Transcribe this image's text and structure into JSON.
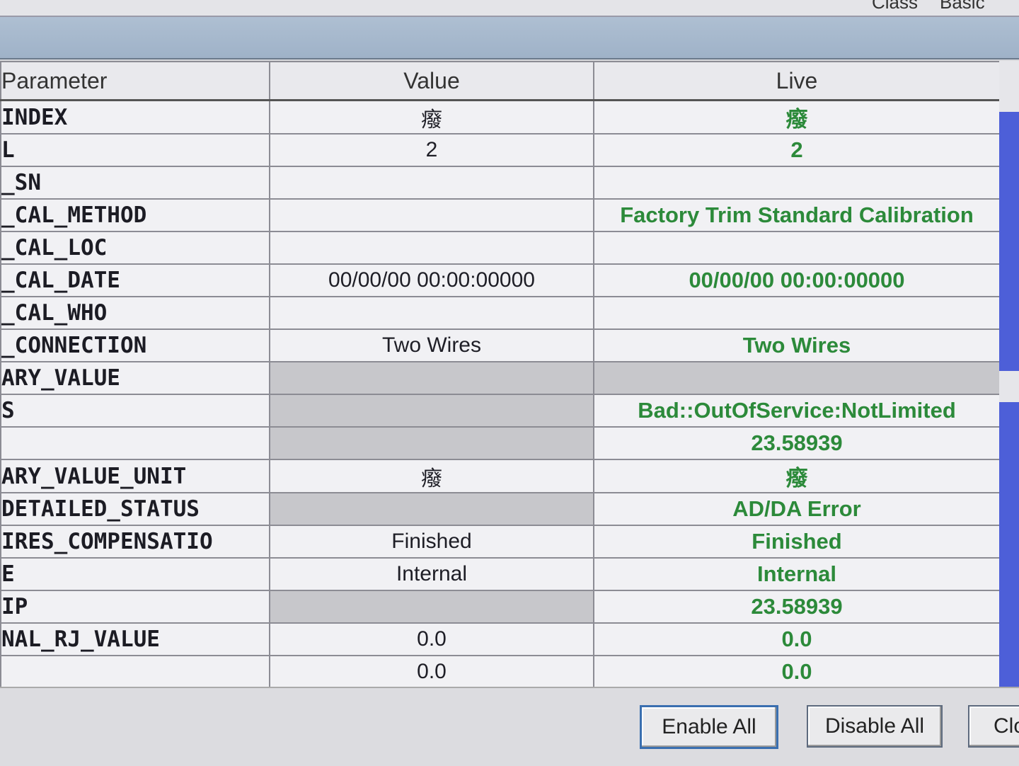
{
  "top_tabs": [
    "Class",
    "Basic"
  ],
  "columns": {
    "parameter": "Parameter",
    "value": "Value",
    "live": "Live"
  },
  "rows": [
    {
      "param": "INDEX",
      "value": "癈",
      "live": "癈",
      "value_disabled": false,
      "live_disabled": false
    },
    {
      "param": "L",
      "value": "2",
      "live": "2",
      "value_disabled": false,
      "live_disabled": false
    },
    {
      "param": "_SN",
      "value": "",
      "live": "",
      "value_disabled": false,
      "live_disabled": false
    },
    {
      "param": "_CAL_METHOD",
      "value": "",
      "live": "Factory Trim Standard Calibration",
      "value_disabled": false,
      "live_disabled": false
    },
    {
      "param": "_CAL_LOC",
      "value": "",
      "live": "",
      "value_disabled": false,
      "live_disabled": false
    },
    {
      "param": "_CAL_DATE",
      "value": "00/00/00 00:00:00000",
      "live": "00/00/00 00:00:00000",
      "value_disabled": false,
      "live_disabled": false
    },
    {
      "param": "_CAL_WHO",
      "value": "",
      "live": "",
      "value_disabled": false,
      "live_disabled": false
    },
    {
      "param": "_CONNECTION",
      "value": "Two Wires",
      "live": "Two Wires",
      "value_disabled": false,
      "live_disabled": false
    },
    {
      "param": "ARY_VALUE",
      "value": "",
      "live": "",
      "value_disabled": true,
      "live_disabled": true
    },
    {
      "param": "S",
      "value": "",
      "live": "Bad::OutOfService:NotLimited",
      "value_disabled": true,
      "live_disabled": false
    },
    {
      "param": "",
      "value": "",
      "live": "23.58939",
      "value_disabled": true,
      "live_disabled": false
    },
    {
      "param": "ARY_VALUE_UNIT",
      "value": "癈",
      "live": "癈",
      "value_disabled": false,
      "live_disabled": false
    },
    {
      "param": "DETAILED_STATUS",
      "value": "",
      "live": "AD/DA Error",
      "value_disabled": true,
      "live_disabled": false
    },
    {
      "param": "IRES_COMPENSATIO",
      "value": "Finished",
      "live": "Finished",
      "value_disabled": false,
      "live_disabled": false
    },
    {
      "param": "E",
      "value": "Internal",
      "live": "Internal",
      "value_disabled": false,
      "live_disabled": false
    },
    {
      "param": "IP",
      "value": "",
      "live": "23.58939",
      "value_disabled": true,
      "live_disabled": false
    },
    {
      "param": "NAL_RJ_VALUE",
      "value": "0.0",
      "live": "0.0",
      "value_disabled": false,
      "live_disabled": false
    },
    {
      "param": "",
      "value": "0.0",
      "live": "0.0",
      "value_disabled": false,
      "live_disabled": false
    }
  ],
  "buttons": {
    "enable_all": "Enable All",
    "disable_all": "Disable All",
    "close": "Clo"
  },
  "colors": {
    "live_text": "#2c8a3a",
    "scrollbar": "#4d5fd8",
    "disabled_cell": "#c7c7cb"
  }
}
